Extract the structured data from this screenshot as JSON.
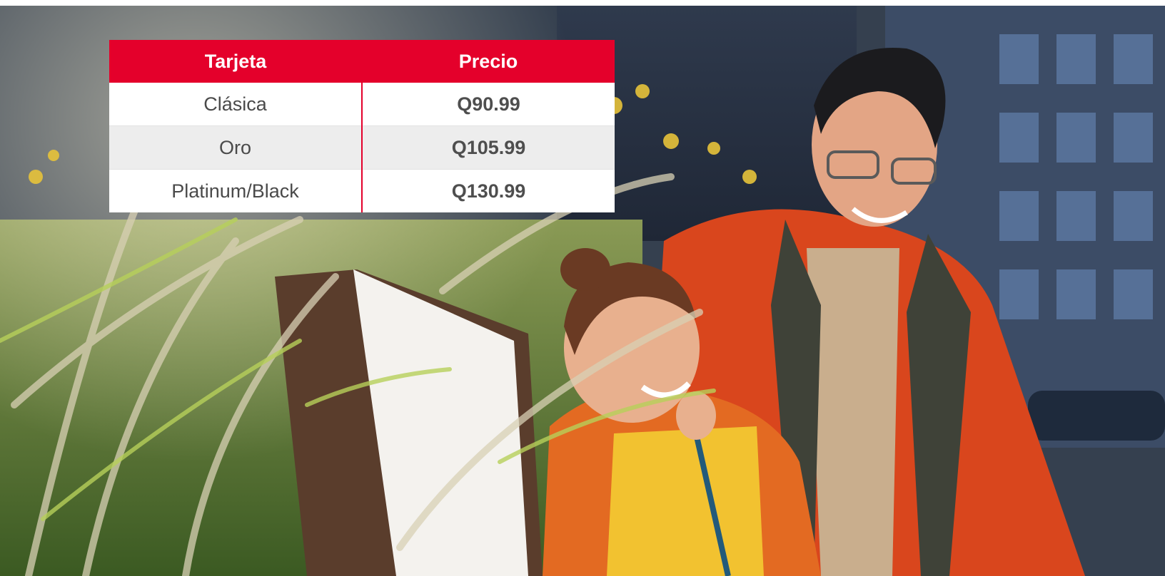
{
  "table": {
    "headers": {
      "card": "Tarjeta",
      "price": "Precio"
    },
    "rows": [
      {
        "card": "Clásica",
        "price": "Q90.99"
      },
      {
        "card": "Oro",
        "price": "Q105.99"
      },
      {
        "card": "Platinum/Black",
        "price": "Q130.99"
      }
    ]
  },
  "colors": {
    "accent": "#e4002b",
    "row_alt": "#ededed",
    "text": "#4a4a4a"
  }
}
